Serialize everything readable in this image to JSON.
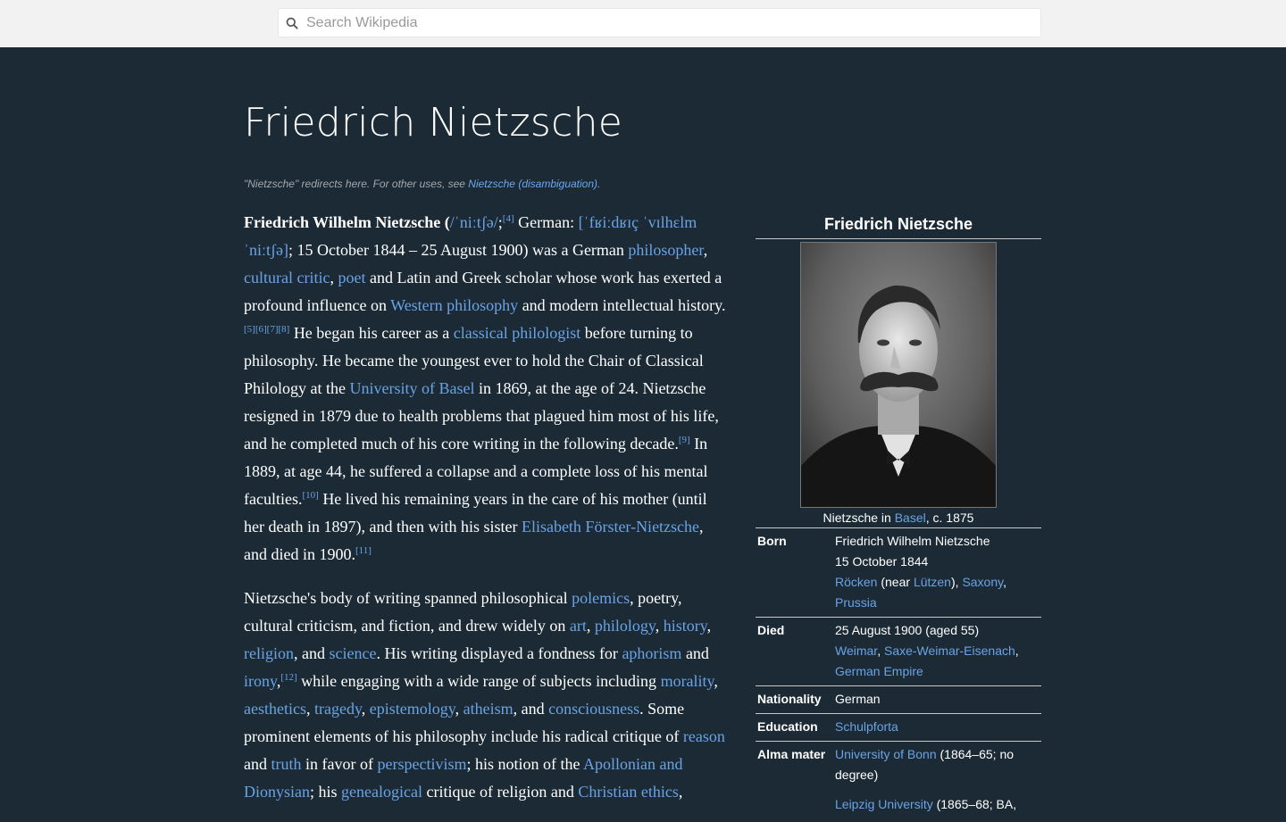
{
  "search": {
    "placeholder": "Search Wikipedia",
    "icon": "search-icon"
  },
  "page": {
    "title": "Friedrich Nietzsche",
    "hatnote": {
      "text": "\"Nietzsche\" redirects here. For other uses, see ",
      "link": "Nietzsche (disambiguation)",
      "after": "."
    }
  },
  "colors": {
    "background": "#1b2a34",
    "link": "#6aa3e6",
    "topbar": "#f2f2f2"
  },
  "paragraph1": {
    "p1": "Friedrich Wilhelm Nietzsche (",
    "ipa1": "/ˈniːtʃə/",
    "p2": ";",
    "ref4": "[4]",
    "p3": " German: ",
    "ipa2": "[ˈfʁiːdʁɪç ˈvɪlhɛlm ˈniːtʃə]",
    "p4": "; 15 October 1844 – 25 August 1900) was a German ",
    "l_philosopher": "philosopher",
    "p5": ", ",
    "l_cultural_critic": "cultural critic",
    "p6": ", ",
    "l_poet": "poet",
    "p7": " and Latin and Greek scholar whose work has exerted a profound influence on ",
    "l_western": "Western philosophy",
    "p8": " and modern intellectual history.",
    "refs5_8": "[5][6][7][8]",
    "p9": " He began his career as a ",
    "l_classical": "classical philologist",
    "p10": " before turning to philosophy. He became the youngest ever to hold the Chair of Classical Philology at the ",
    "l_basel": "University of Basel",
    "p11": " in 1869, at the age of 24. Nietzsche resigned in 1879 due to health problems that plagued him most of his life, and he completed much of his core writing in the following decade.",
    "ref9": "[9]",
    "p12": " In 1889, at age 44, he suffered a collapse and a complete loss of his mental faculties.",
    "ref10": "[10]",
    "p13": " He lived his remaining years in the care of his mother (until her death in 1897), and then with his sister ",
    "l_elisabeth": "Elisabeth Förster-Nietzsche",
    "p14": ", and died in 1900.",
    "ref11": "[11]"
  },
  "paragraph2": {
    "p1": "Nietzsche's body of writing spanned philosophical ",
    "l_polemics": "polemics",
    "p2": ", poetry, cultural criticism, and fiction, and drew widely on ",
    "l_art": "art",
    "p3": ", ",
    "l_philology": "philology",
    "p4": ", ",
    "l_history": "history",
    "p5": ", ",
    "l_religion": "religion",
    "p6": ", and ",
    "l_science": "science",
    "p7": ". His writing displayed a fondness for ",
    "l_aphorism": "aphorism",
    "p8": " and ",
    "l_irony": "irony",
    "p9": ",",
    "ref12": "[12]",
    "p10": " while engaging with a wide range of subjects including ",
    "l_morality": "morality",
    "p11": ", ",
    "l_aesthetics": "aesthetics",
    "p12": ", ",
    "l_tragedy": "tragedy",
    "p13": ", ",
    "l_epistemology": "epistemology",
    "p14": ", ",
    "l_atheism": "atheism",
    "p15": ", and ",
    "l_consciousness": "consciousness",
    "p16": ". Some prominent elements of his philosophy include his radical critique of ",
    "l_reason": "reason",
    "p17": " and ",
    "l_truth": "truth",
    "p18": " in favor of ",
    "l_perspectivism": "perspectivism",
    "p19": "; his notion of the ",
    "l_apollonian": "Apollonian and Dionysian",
    "p20": "; his ",
    "l_genealogical": "genealogical",
    "p21": " critique of religion and ",
    "l_christian": "Christian ethics",
    "p22": ","
  },
  "infobox": {
    "title": "Friedrich Nietzsche",
    "caption_pre": "Nietzsche in ",
    "caption_link": "Basel",
    "caption_post": ", c. 1875",
    "born": {
      "label": "Born",
      "name": "Friedrich Wilhelm Nietzsche",
      "date": "15 October 1844",
      "place_rocken": "Röcken",
      "place_near": " (near ",
      "place_lutzen": "Lützen",
      "place_close": "), ",
      "place_saxony": "Saxony",
      "place_comma": ",",
      "place_prussia": "Prussia"
    },
    "died": {
      "label": "Died",
      "date": "25 August 1900 (aged 55)",
      "place_weimar": "Weimar",
      "place_comma1": ", ",
      "place_saxe": "Saxe-Weimar-Eisenach",
      "place_comma2": ",",
      "place_empire": "German Empire"
    },
    "nationality": {
      "label": "Nationality",
      "value": "German"
    },
    "education": {
      "label": "Education",
      "value": "Schulpforta"
    },
    "alma_mater": {
      "label": "Alma mater",
      "bonn": "University of Bonn",
      "bonn_note": " (1864–65; no degree)",
      "leipzig": "Leipzig University",
      "leipzig_note": " (1865–68; BA,"
    }
  }
}
